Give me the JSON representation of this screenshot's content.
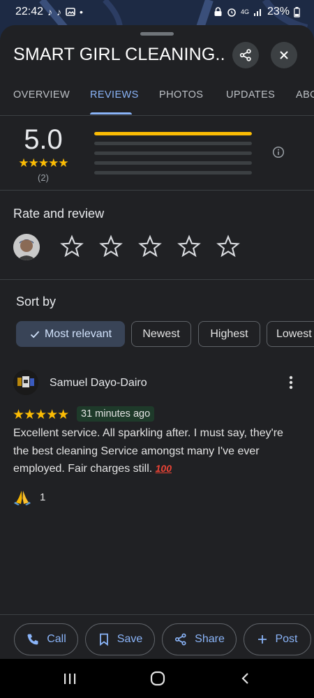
{
  "status_bar": {
    "time": "22:42",
    "network": "4G",
    "battery": "23%"
  },
  "header": {
    "title": "SMART GIRL CLEANING..."
  },
  "tabs": [
    {
      "label": "OVERVIEW"
    },
    {
      "label": "REVIEWS"
    },
    {
      "label": "PHOTOS"
    },
    {
      "label": "UPDATES"
    },
    {
      "label": "ABO"
    }
  ],
  "rating_summary": {
    "average": "5.0",
    "stars": "★★★★★",
    "count": "(2)",
    "distribution": [
      1,
      0,
      0,
      0,
      0
    ]
  },
  "rate_and_review": {
    "title": "Rate and review"
  },
  "sort": {
    "title": "Sort by",
    "options": [
      {
        "label": "Most relevant"
      },
      {
        "label": "Newest"
      },
      {
        "label": "Highest"
      },
      {
        "label": "Lowest"
      }
    ]
  },
  "review": {
    "author": "Samuel Dayo-Dairo",
    "stars": "★★★★★",
    "time": "31 minutes ago",
    "text": "Excellent service. All sparkling after. I must say, they're the best cleaning Service amongst many I've ever employed. Fair charges still.",
    "emoji": "100",
    "reaction_count": "1"
  },
  "actions": [
    {
      "label": "Call"
    },
    {
      "label": "Save"
    },
    {
      "label": "Share"
    },
    {
      "label": "Post"
    }
  ],
  "colors": {
    "accent": "#8ab4f8",
    "star": "#fbbc04",
    "sheet": "#202124"
  }
}
